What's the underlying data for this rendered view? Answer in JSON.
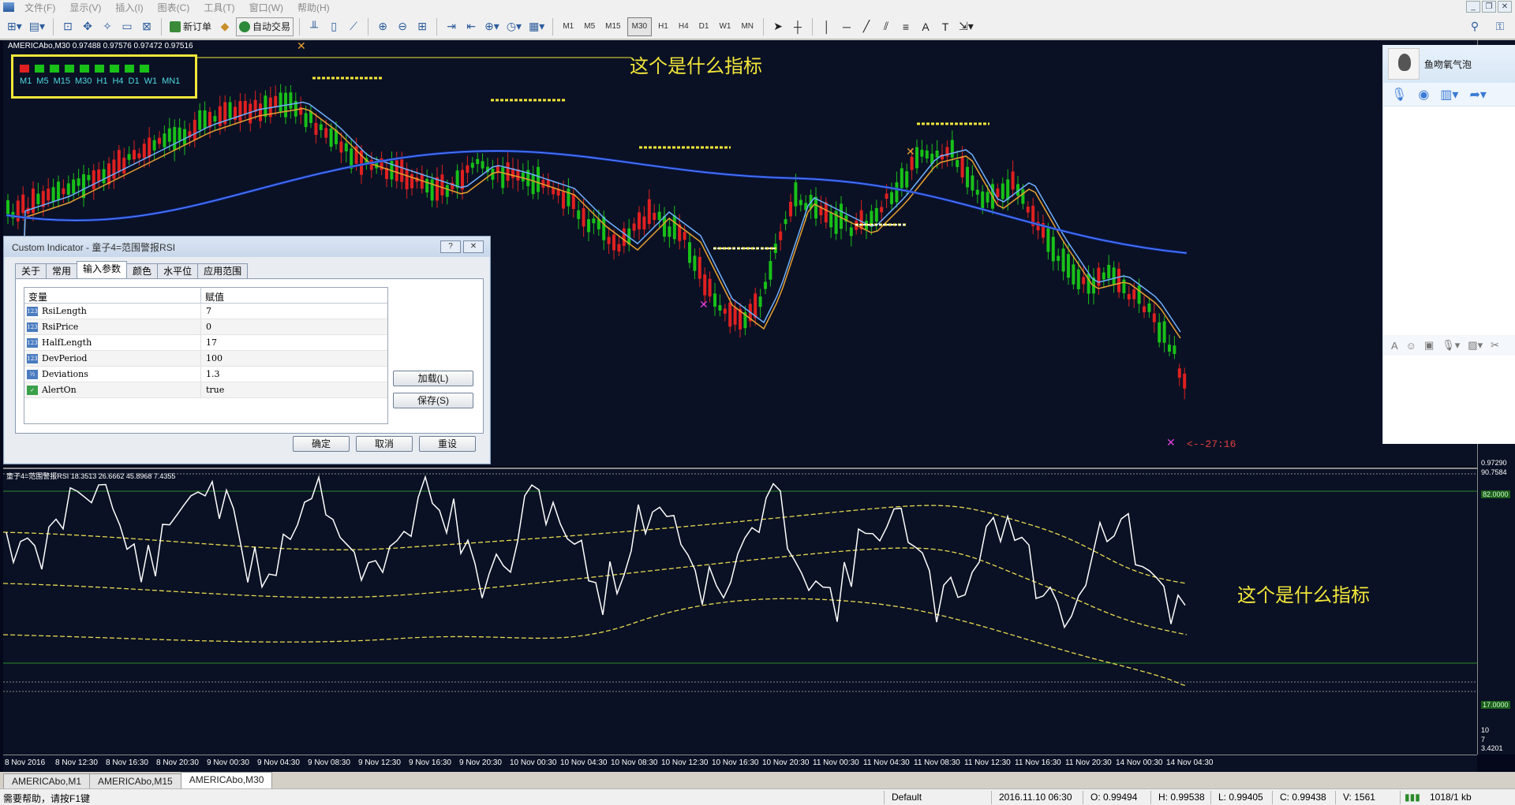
{
  "menu": [
    "文件(F)",
    "显示(V)",
    "插入(I)",
    "图表(C)",
    "工具(T)",
    "窗口(W)",
    "帮助(H)"
  ],
  "toolbar": {
    "new_order": "新订单",
    "auto_trading": "自动交易",
    "timeframes": [
      "M1",
      "M5",
      "M15",
      "M30",
      "H1",
      "H4",
      "D1",
      "W1",
      "MN"
    ],
    "active_timeframe": "M30"
  },
  "chart": {
    "header": "AMERICAbo,M30  0.97488 0.97576 0.97472 0.97516",
    "annotation_top": "这个是什么指标",
    "annotation_bottom": "这个是什么指标",
    "tf_panel_labels": [
      "M1",
      "M5",
      "M15",
      "M30",
      "H1",
      "H4",
      "D1",
      "W1",
      "MN1"
    ],
    "countdown": "<--27:16",
    "sub_header": "童子4=范围警报RSI 18.3513 26.6662 45.8968 7.4355",
    "price_labels": [
      "0.97290",
      "90.7584",
      "82.0000",
      "17.0000",
      "10",
      "7",
      "3.4201"
    ],
    "time_labels": [
      "8 Nov 2016",
      "8 Nov 12:30",
      "8 Nov 16:30",
      "8 Nov 20:30",
      "9 Nov 00:30",
      "9 Nov 04:30",
      "9 Nov 08:30",
      "9 Nov 12:30",
      "9 Nov 16:30",
      "9 Nov 20:30",
      "10 Nov 00:30",
      "10 Nov 04:30",
      "10 Nov 08:30",
      "10 Nov 12:30",
      "10 Nov 16:30",
      "10 Nov 20:30",
      "11 Nov 00:30",
      "11 Nov 04:30",
      "11 Nov 08:30",
      "11 Nov 12:30",
      "11 Nov 16:30",
      "11 Nov 20:30",
      "14 Nov 00:30",
      "14 Nov 04:30"
    ]
  },
  "chat": {
    "name": "鱼吻氧气泡"
  },
  "dialog": {
    "title": "Custom Indicator - 童子4=范围警报RSI",
    "help_btn": "?",
    "close_btn": "✕",
    "tabs": [
      "关于",
      "常用",
      "输入参数",
      "颜色",
      "水平位",
      "应用范围"
    ],
    "active_tab": "输入参数",
    "col_variable": "变量",
    "col_value": "赋值",
    "params": [
      {
        "name": "RsiLength",
        "value": "7",
        "type": "123"
      },
      {
        "name": "RsiPrice",
        "value": "0",
        "type": "123"
      },
      {
        "name": "HalfLength",
        "value": "17",
        "type": "123"
      },
      {
        "name": "DevPeriod",
        "value": "100",
        "type": "123"
      },
      {
        "name": "Deviations",
        "value": "1.3",
        "type": "½"
      },
      {
        "name": "AlertOn",
        "value": "true",
        "type": "bool"
      }
    ],
    "load_btn": "加载(L)",
    "save_btn": "保存(S)",
    "ok_btn": "确定",
    "cancel_btn": "取消",
    "reset_btn": "重设"
  },
  "chart_tabs": [
    "AMERICAbo,M1",
    "AMERICAbo,M15",
    "AMERICAbo,M30"
  ],
  "active_chart_tab": "AMERICAbo,M30",
  "status": {
    "help": "需要帮助，请按F1键",
    "profile": "Default",
    "datetime": "2016.11.10 06:30",
    "open": "O: 0.99494",
    "high": "H: 0.99538",
    "low": "L: 0.99405",
    "close": "C: 0.99438",
    "volume": "V: 1561",
    "traffic": "1018/1 kb"
  },
  "colors": {
    "background": "#0a1124",
    "bull_candle": "#18c018",
    "bear_candle": "#e02020",
    "annotation": "#f2e63a",
    "rsi_line": "#ffffff",
    "band_line": "#e8d850"
  }
}
